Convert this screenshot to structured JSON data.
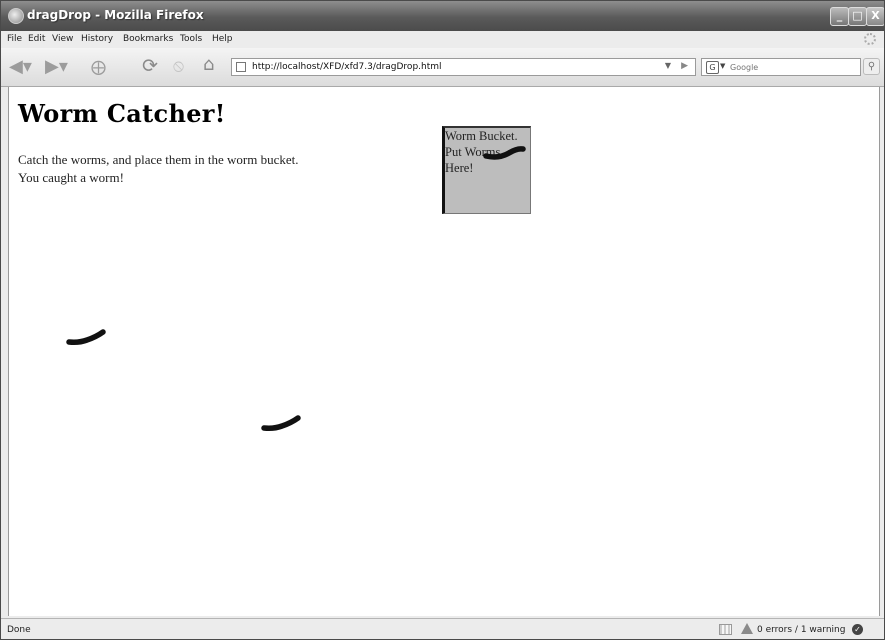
{
  "window": {
    "title": "dragDrop - Mozilla Firefox",
    "controls": {
      "minimize": "_",
      "maximize": "□",
      "close": "X"
    }
  },
  "menubar": {
    "items": [
      "File",
      "Edit",
      "View",
      "History",
      "Bookmarks",
      "Tools",
      "Help"
    ]
  },
  "toolbar": {
    "icons": [
      "back-icon",
      "forward-icon",
      "new-tab-icon",
      "reload-icon",
      "stop-icon",
      "home-icon"
    ],
    "url": "http://localhost/XFD/xfd7.3/dragDrop.html",
    "search_placeholder": "Google"
  },
  "page": {
    "heading": "Worm Catcher!",
    "instruction": "Catch the worms, and place them in the worm bucket.",
    "message": "You caught a worm!",
    "bucket_lines": [
      "Worm Bucket.",
      "Put Worms",
      "Here!"
    ],
    "worm_count_on_page": 3
  },
  "statusbar": {
    "status": "Done",
    "errors": "0 errors / 1 warning"
  }
}
